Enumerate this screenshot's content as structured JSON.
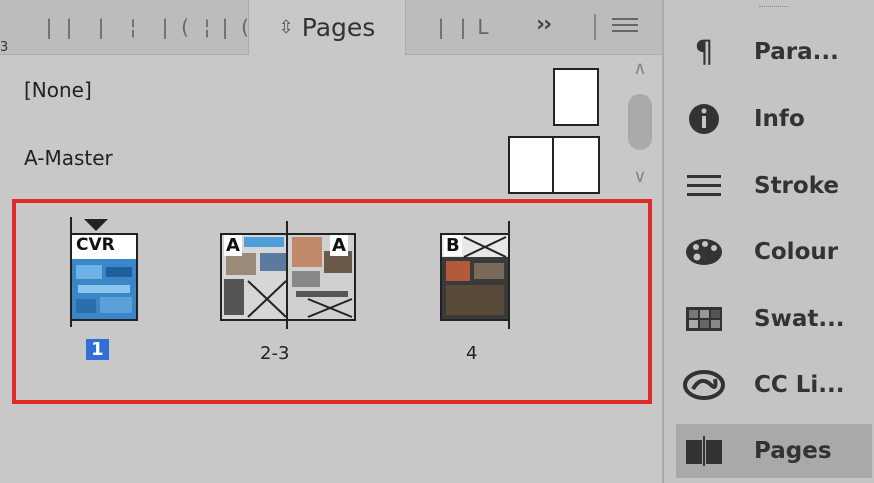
{
  "tabs": {
    "active_label": "Pages",
    "sort_glyph": "⇳",
    "more_glyph": "››",
    "collapsed_glyphs": [
      "|",
      "|",
      "|",
      "¦",
      "|",
      "(",
      "¦",
      "|",
      "(",
      "|",
      "|",
      "L"
    ]
  },
  "edge_mark": "3",
  "masters": [
    {
      "label": "[None]",
      "kind": "single"
    },
    {
      "label": "A-Master",
      "kind": "spread"
    }
  ],
  "pages": [
    {
      "label": "1",
      "prefix": "CVR",
      "selected": true,
      "kind": "single"
    },
    {
      "label": "2-3",
      "prefixes": [
        "A",
        "A"
      ],
      "selected": false,
      "kind": "spread"
    },
    {
      "label": "4",
      "prefix": "B",
      "selected": false,
      "kind": "single"
    }
  ],
  "scrollbar": {
    "up_glyph": "∧",
    "down_glyph": "∨"
  },
  "highlight_color": "#e02b2b",
  "selection_color": "#2f6fd6",
  "dock": [
    {
      "label": "Para...",
      "icon": "paragraph-icon",
      "glyph": "¶",
      "active": false
    },
    {
      "label": "Info",
      "icon": "info-icon",
      "glyph": "ℹ",
      "active": false
    },
    {
      "label": "Stroke",
      "icon": "stroke-icon",
      "glyph": "≡",
      "active": false
    },
    {
      "label": "Colour",
      "icon": "palette-icon",
      "glyph": "◐",
      "active": false
    },
    {
      "label": "Swat...",
      "icon": "swatches-icon",
      "glyph": "▦",
      "active": false
    },
    {
      "label": "CC Li...",
      "icon": "cc-libraries-icon",
      "glyph": "∞",
      "active": false
    },
    {
      "label": "Pages",
      "icon": "pages-icon",
      "glyph": "◫",
      "active": true
    }
  ]
}
